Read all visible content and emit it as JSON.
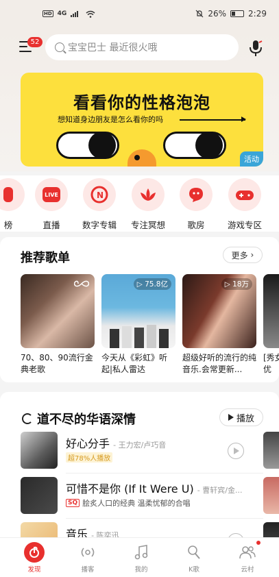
{
  "status_bar": {
    "hd": "HD",
    "network": "4G",
    "battery_percent": "26%",
    "time": "2:29"
  },
  "header": {
    "notification_badge": "52",
    "search_placeholder": "宝宝巴士 最近很火哦"
  },
  "banner": {
    "title": "看看你的性格泡泡",
    "subtitle": "想知道身边朋友是怎么看你的吗",
    "tag": "活动",
    "background_color": "#fde03d"
  },
  "categories": [
    {
      "label": "榜",
      "icon": "chart-icon"
    },
    {
      "label": "直播",
      "icon": "live-icon",
      "icon_text": "LIVE"
    },
    {
      "label": "数字专辑",
      "icon": "album-icon"
    },
    {
      "label": "专注冥想",
      "icon": "lotus-icon"
    },
    {
      "label": "歌房",
      "icon": "karaoke-room-icon"
    },
    {
      "label": "游戏专区",
      "icon": "gamepad-icon"
    }
  ],
  "recommended": {
    "title": "推荐歌单",
    "more": "更多",
    "playlists": [
      {
        "title": "70、80、90流行金典老歌",
        "count": ""
      },
      {
        "title": "今天从《彩虹》听起|私人雷达",
        "count": "75.8亿"
      },
      {
        "title": "超级好听的流行的纯音乐.会常更新...",
        "count": "18万"
      },
      {
        "title": "[秀女优",
        "count": ""
      }
    ]
  },
  "hot": {
    "title": "道不尽的华语深情",
    "play": "播放",
    "songs": [
      {
        "name": "好心分手",
        "artist": "- 王力宏/卢巧音",
        "tag": "超78%人播放",
        "desc": ""
      },
      {
        "name": "可惜不是你 (If It Were U)",
        "artist": "- 曹轩宾/金...",
        "tag": "SQ",
        "desc": "脍炙人口的经典 温柔忧郁的合唱"
      },
      {
        "name": "音乐",
        "artist": "- 陈奕迅",
        "tag": "",
        "desc": ""
      }
    ]
  },
  "tabbar": [
    {
      "label": "发现",
      "icon": "netease-music-icon",
      "active": true
    },
    {
      "label": "播客",
      "icon": "podcast-icon",
      "active": false
    },
    {
      "label": "我的",
      "icon": "music-note-icon",
      "active": false
    },
    {
      "label": "K歌",
      "icon": "karaoke-mic-icon",
      "active": false
    },
    {
      "label": "云村",
      "icon": "community-icon",
      "active": false
    }
  ],
  "colors": {
    "brand_red": "#e8302e"
  }
}
